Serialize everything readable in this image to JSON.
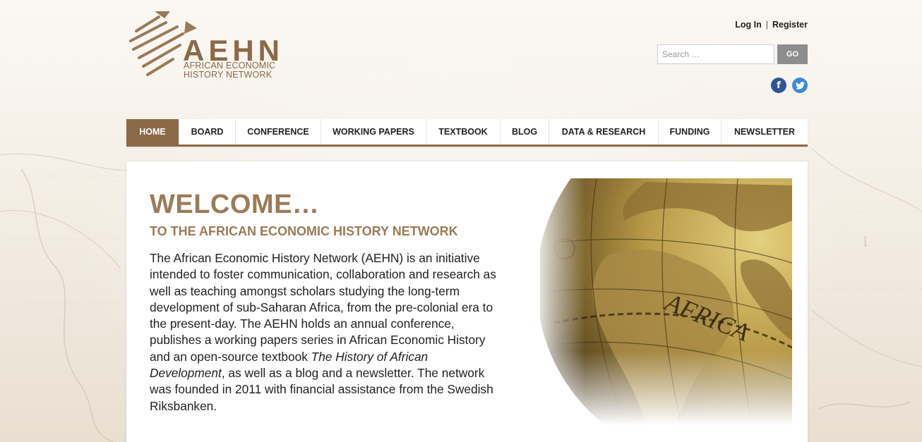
{
  "logo": {
    "acronym": "AEHN",
    "subtitle_line1": "AFRICAN ECONOMIC",
    "subtitle_line2": "HISTORY NETWORK"
  },
  "account": {
    "login_label": "Log In",
    "separator": "|",
    "register_label": "Register"
  },
  "search": {
    "placeholder": "Search …",
    "button_label": "GO"
  },
  "social": {
    "facebook_glyph": "f",
    "twitter_glyph": "t"
  },
  "nav": {
    "items": [
      {
        "label": "HOME",
        "active": true
      },
      {
        "label": "BOARD"
      },
      {
        "label": "CONFERENCE"
      },
      {
        "label": "WORKING PAPERS"
      },
      {
        "label": "TEXTBOOK"
      },
      {
        "label": "BLOG"
      },
      {
        "label": "DATA & RESEARCH"
      },
      {
        "label": "FUNDING"
      },
      {
        "label": "NEWSLETTER"
      }
    ]
  },
  "main": {
    "heading": "WELCOME…",
    "subheading": "TO THE AFRICAN ECONOMIC HISTORY NETWORK",
    "intro_part1": "The African Economic History Network (AEHN) is an initiative intended to foster communication, collaboration and research as well as teaching amongst scholars studying the long-term development of sub-Saharan Africa, from the pre-colonial era to the present-day. The AEHN holds an annual conference, publishes a working papers series in African Economic History and an open-source textbook ",
    "intro_italic": "The History of African Development",
    "intro_part2": ", as well as a blog and a newsletter. The network was founded in 2011 with financial assistance from the Swedish Riksbanken."
  },
  "colors": {
    "brand": "#8a6a48",
    "heading": "#9b7b58",
    "facebook": "#2f5597",
    "twitter": "#3e8bd6"
  },
  "icons": {
    "logo": "africa-map-arrow-logo",
    "facebook": "facebook-icon",
    "twitter": "twitter-icon",
    "hero": "globe-africa-image"
  }
}
